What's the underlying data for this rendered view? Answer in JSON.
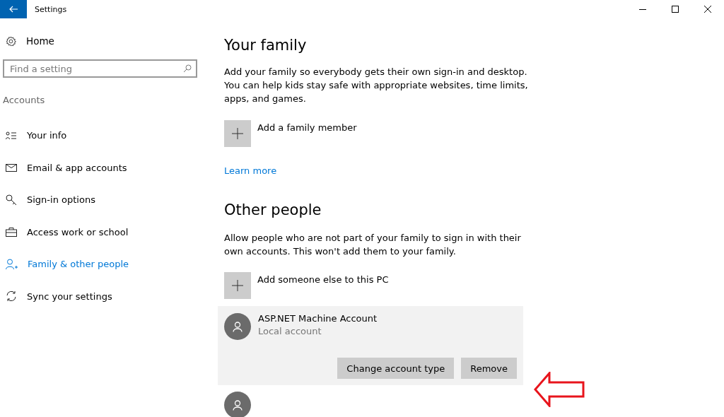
{
  "window": {
    "title": "Settings"
  },
  "sidebar": {
    "home": "Home",
    "search": {
      "placeholder": "Find a setting"
    },
    "section": "Accounts",
    "items": [
      {
        "kind": "info",
        "label": "Your info",
        "selected": false
      },
      {
        "kind": "mail",
        "label": "Email & app accounts",
        "selected": false
      },
      {
        "kind": "key",
        "label": "Sign-in options",
        "selected": false
      },
      {
        "kind": "briefcase",
        "label": "Access work or school",
        "selected": false
      },
      {
        "kind": "people",
        "label": "Family & other people",
        "selected": true
      },
      {
        "kind": "sync",
        "label": "Sync your settings",
        "selected": false
      }
    ]
  },
  "family": {
    "heading": "Your family",
    "description": "Add your family so everybody gets their own sign-in and desktop. You can help kids stay safe with appropriate websites, time limits, apps, and games.",
    "add": "Add a family member",
    "link": "Learn more"
  },
  "other_people": {
    "heading": "Other people",
    "description": "Allow people who are not part of your family to sign in with their own accounts. This won't add them to your family.",
    "add": "Add someone else to this PC",
    "accounts": [
      {
        "name": "ASP.NET Machine Account",
        "type": "Local account",
        "expanded": true,
        "buttons": [
          "Change account type",
          "Remove"
        ]
      },
      {
        "expanded": false
      }
    ]
  }
}
